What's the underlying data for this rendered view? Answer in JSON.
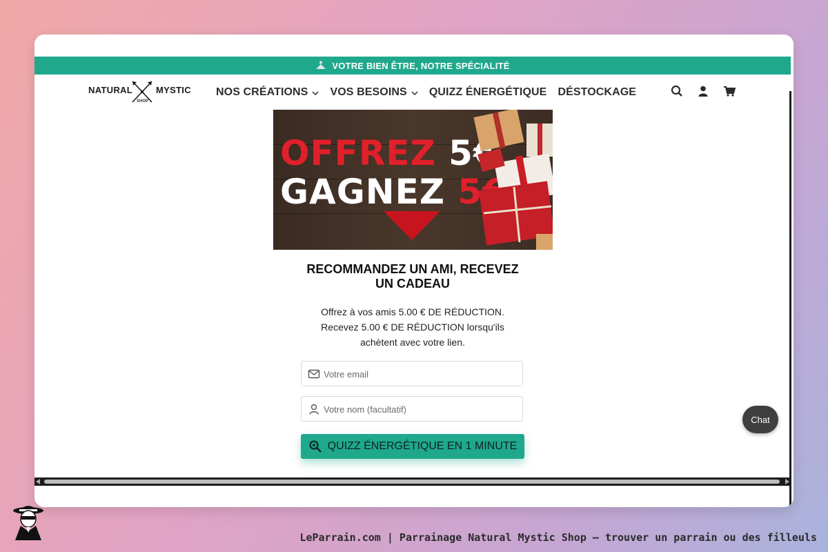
{
  "banner": {
    "text": "VOTRE BIEN ÊTRE, NOTRE SPÉCIALITÉ",
    "icon": "meditation-icon"
  },
  "logo": {
    "left_word": "NATURAL",
    "right_word": "MYSTIC",
    "sub": "SHOP"
  },
  "nav": {
    "items": [
      {
        "label": "NOS CRÉATIONS",
        "has_dropdown": true
      },
      {
        "label": "VOS BESOINS",
        "has_dropdown": true
      },
      {
        "label": "QUIZZ ÉNERGÉTIQUE",
        "has_dropdown": false
      },
      {
        "label": "DÉSTOCKAGE",
        "has_dropdown": false
      }
    ],
    "icons": [
      "search-icon",
      "account-icon",
      "cart-icon"
    ]
  },
  "hero": {
    "offer_word": "OFFREZ",
    "offer_amount": "5€",
    "gain_word": "GAGNEZ",
    "gain_amount": "5€"
  },
  "referral": {
    "title": "RECOMMANDEZ UN AMI, RECEVEZ UN CADEAU",
    "line1": "Offrez à vos amis 5.00 € DE RÉDUCTION.",
    "line2": "Recevez 5.00 € DE RÉDUCTION lorsqu'ils",
    "line3": "achètent avec votre lien.",
    "email_placeholder": "Votre email",
    "name_placeholder": "Votre nom (facultatif)",
    "cta_label": "QUIZZ ÉNERGÉTIQUE EN 1 MINUTE"
  },
  "chat": {
    "label": "Chat"
  },
  "footer": {
    "caption": "LeParrain.com | Parrainage Natural Mystic Shop — trouver un parrain ou des filleuls"
  },
  "colors": {
    "accent": "#1fa88c",
    "hero_red": "#e0202a",
    "text_dark": "#2e2e2e"
  }
}
